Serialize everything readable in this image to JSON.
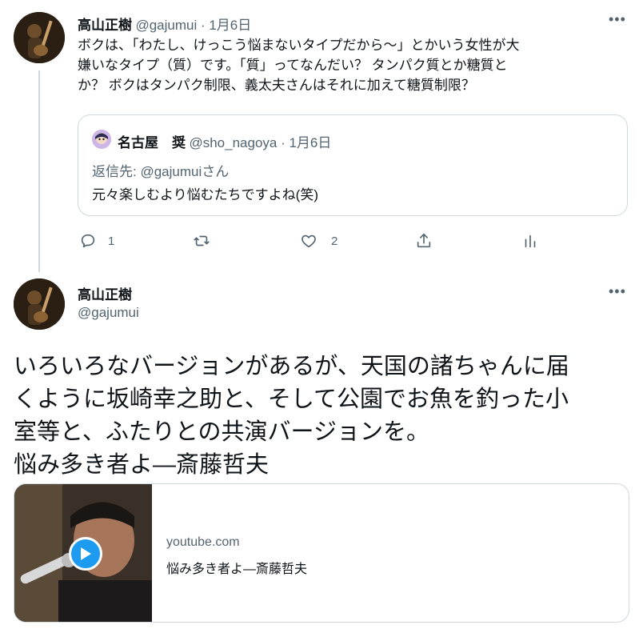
{
  "reply_tweet": {
    "author_name": "高山正樹",
    "handle_date": "@gajumui · 1月6日",
    "text_line1": "ボクは、「わたし、けっこう悩まないタイプだから～」とかいう女性が大",
    "text_line2": "嫌いなタイプ（質）です。「質」ってなんだい？ タンパク質とか糖質と",
    "text_line3": "か？ ボクはタンパク制限、義太夫さんはそれに加えて糖質制限？",
    "quote": {
      "author_name": "名古屋　奨",
      "handle_date": "@sho_nagoya · 1月6日",
      "reply_to": "返信先: @gajumuiさん",
      "text": "元々楽しむより悩むたちですよね(笑)"
    },
    "actions": {
      "reply_count": "1",
      "retweet_count": "",
      "like_count": "2"
    }
  },
  "main_tweet": {
    "author_name": "高山正樹",
    "handle": "@gajumui",
    "text_line1": "いろいろなバージョンがあるが、天国の諸ちゃんに届",
    "text_line2": "くように坂崎幸之助と、そして公園でお魚を釣った小",
    "text_line3": "室等と、ふたりとの共演バージョンを。",
    "text_line4": "悩み多き者よ—斎藤哲夫",
    "link_card": {
      "domain": "youtube.com",
      "title": "悩み多き者よ—斎藤哲夫"
    }
  },
  "colors": {
    "accent": "#1d9bf0",
    "muted": "#536471",
    "border": "#cfd9de"
  },
  "icons": [
    "more-icon",
    "reply-icon",
    "retweet-icon",
    "like-icon",
    "share-icon",
    "analytics-icon",
    "play-icon"
  ]
}
